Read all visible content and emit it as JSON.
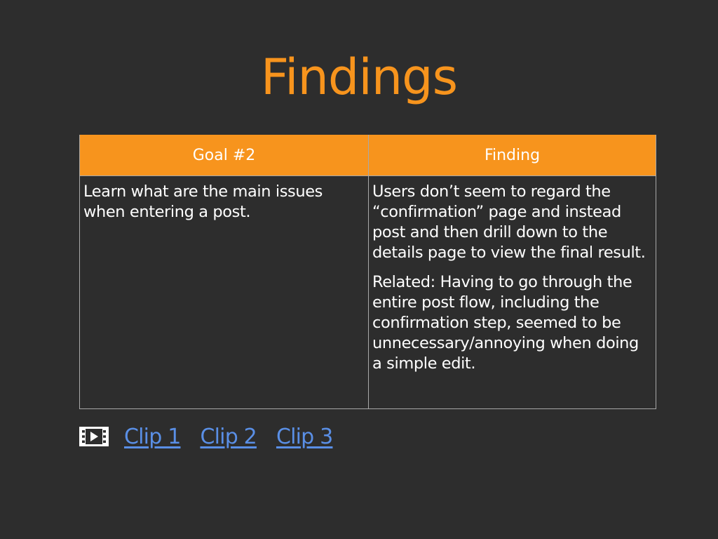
{
  "slide": {
    "title": "Findings"
  },
  "table": {
    "headers": {
      "goal": "Goal #2",
      "finding": "Finding"
    },
    "goal_text": "Learn what are the main issues when entering a post.",
    "finding_paragraphs": [
      "Users don’t seem to regard the “confirmation” page and instead post and then drill down to the details page to view the final result.",
      "Related: Having to go through the entire post flow, including the confirmation step, seemed to be unnecessary/annoying when doing a simple edit."
    ]
  },
  "clips": {
    "icon": "film-icon",
    "links": [
      "Clip 1",
      "Clip 2",
      "Clip 3"
    ]
  },
  "colors": {
    "background": "#2d2d2d",
    "accent": "#f7941d",
    "link": "#5a8fe6",
    "text": "#ffffff"
  }
}
